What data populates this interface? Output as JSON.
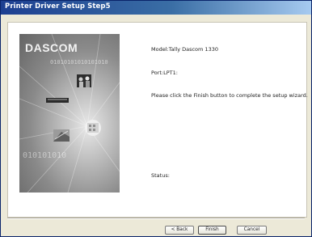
{
  "window": {
    "title": "Printer Driver Setup Step5"
  },
  "banner": {
    "brand": "DASCOM",
    "binary_top": "01010101010101010",
    "binary_bottom": "010101010"
  },
  "info": {
    "model_line": "Model:Tally Dascom 1330",
    "port_line": "Port:LPT1:",
    "instruction": "Please click the Finish button to complete the setup wizard.",
    "status_label": "Status:"
  },
  "buttons": {
    "back": "< Back",
    "finish": "Finish",
    "cancel": "Cancel"
  },
  "colors": {
    "titlebar_start": "#1d3f91",
    "titlebar_end": "#a6caf0",
    "dialog_background": "#ece9d8"
  }
}
